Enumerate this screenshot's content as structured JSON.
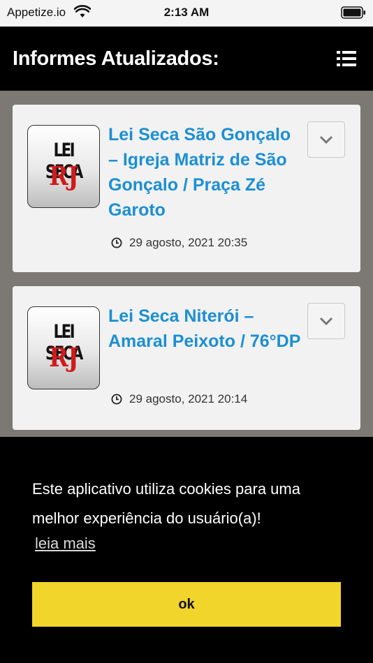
{
  "status_bar": {
    "carrier": "Appetize.io",
    "time": "2:13 AM"
  },
  "header": {
    "title": "Informes Atualizados:",
    "menu_icon": "list-icon"
  },
  "posts": [
    {
      "logo_top": "LEI SECA",
      "logo_bottom": "RJ",
      "title": "Lei Seca São Gonçalo – Igreja Matriz de São Gonçalo / Praça Zé Garoto",
      "date": "29 agosto, 2021 20:35"
    },
    {
      "logo_top": "LEI SECA",
      "logo_bottom": "RJ",
      "title": "Lei Seca Niterói – Amaral Peixoto / 76°DP",
      "date": "29 agosto, 2021 20:14"
    }
  ],
  "cookie_banner": {
    "message": "Este aplicativo  utiliza cookies para uma melhor experiência do usuário(a)!",
    "link_label": "leia mais",
    "ok_label": "ok",
    "button_color": "#f1d52a"
  },
  "colors": {
    "title_blue": "#1b8fd3",
    "header_bg": "#000000",
    "page_bg": "#7c7974"
  }
}
